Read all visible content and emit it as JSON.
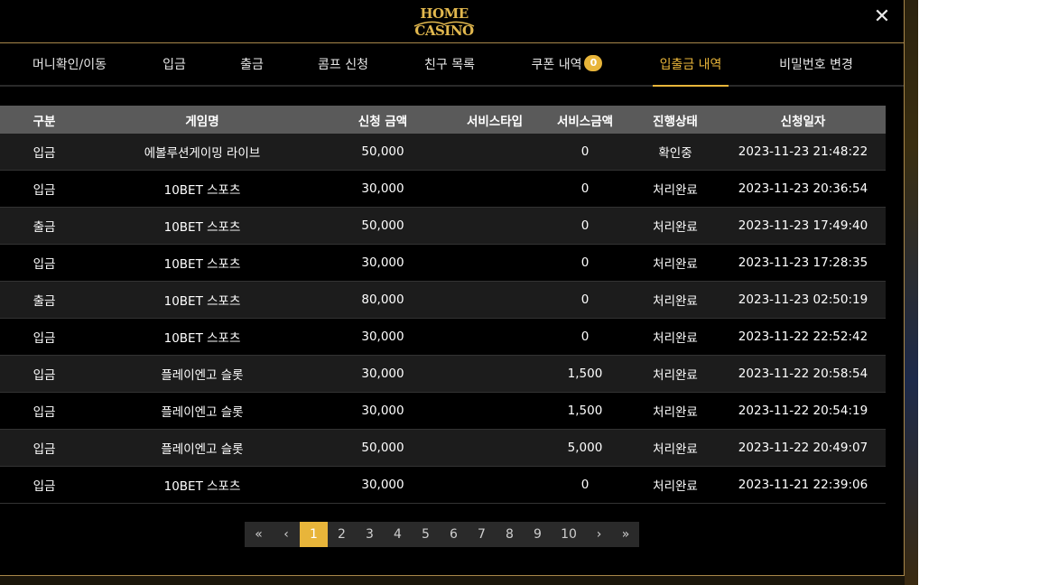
{
  "header": {
    "logo_text": "HOME CASINO",
    "close_label": "✕"
  },
  "tabs": [
    {
      "label": "머니확인/이동"
    },
    {
      "label": "입금"
    },
    {
      "label": "출금"
    },
    {
      "label": "콤프 신청"
    },
    {
      "label": "친구 목록"
    },
    {
      "label": "쿠폰 내역",
      "badge": "0"
    },
    {
      "label": "입출금 내역",
      "active": true
    },
    {
      "label": "비밀번호 변경"
    }
  ],
  "table": {
    "columns": [
      "구분",
      "게임명",
      "신청 금액",
      "서비스타입",
      "서비스금액",
      "진행상태",
      "신청일자"
    ],
    "rows": [
      [
        "입금",
        "에볼루션게이밍 라이브",
        "50,000",
        "",
        "0",
        "확인중",
        "2023-11-23 21:48:22"
      ],
      [
        "입금",
        "10BET 스포츠",
        "30,000",
        "",
        "0",
        "처리완료",
        "2023-11-23 20:36:54"
      ],
      [
        "출금",
        "10BET 스포츠",
        "50,000",
        "",
        "0",
        "처리완료",
        "2023-11-23 17:49:40"
      ],
      [
        "입금",
        "10BET 스포츠",
        "30,000",
        "",
        "0",
        "처리완료",
        "2023-11-23 17:28:35"
      ],
      [
        "출금",
        "10BET 스포츠",
        "80,000",
        "",
        "0",
        "처리완료",
        "2023-11-23 02:50:19"
      ],
      [
        "입금",
        "10BET 스포츠",
        "30,000",
        "",
        "0",
        "처리완료",
        "2023-11-22 22:52:42"
      ],
      [
        "입금",
        "플레이엔고 슬롯",
        "30,000",
        "",
        "1,500",
        "처리완료",
        "2023-11-22 20:58:54"
      ],
      [
        "입금",
        "플레이엔고 슬롯",
        "30,000",
        "",
        "1,500",
        "처리완료",
        "2023-11-22 20:54:19"
      ],
      [
        "입금",
        "플레이엔고 슬롯",
        "50,000",
        "",
        "5,000",
        "처리완료",
        "2023-11-22 20:49:07"
      ],
      [
        "입금",
        "10BET 스포츠",
        "30,000",
        "",
        "0",
        "처리완료",
        "2023-11-21 22:39:06"
      ]
    ]
  },
  "pagination": {
    "first": "«",
    "prev": "‹",
    "pages": [
      "1",
      "2",
      "3",
      "4",
      "5",
      "6",
      "7",
      "8",
      "9",
      "10"
    ],
    "current": "1",
    "next": "›",
    "last": "»"
  },
  "colors": {
    "accent": "#e8b53a",
    "border": "#a8874a",
    "header_row": "#5a5a5a"
  }
}
